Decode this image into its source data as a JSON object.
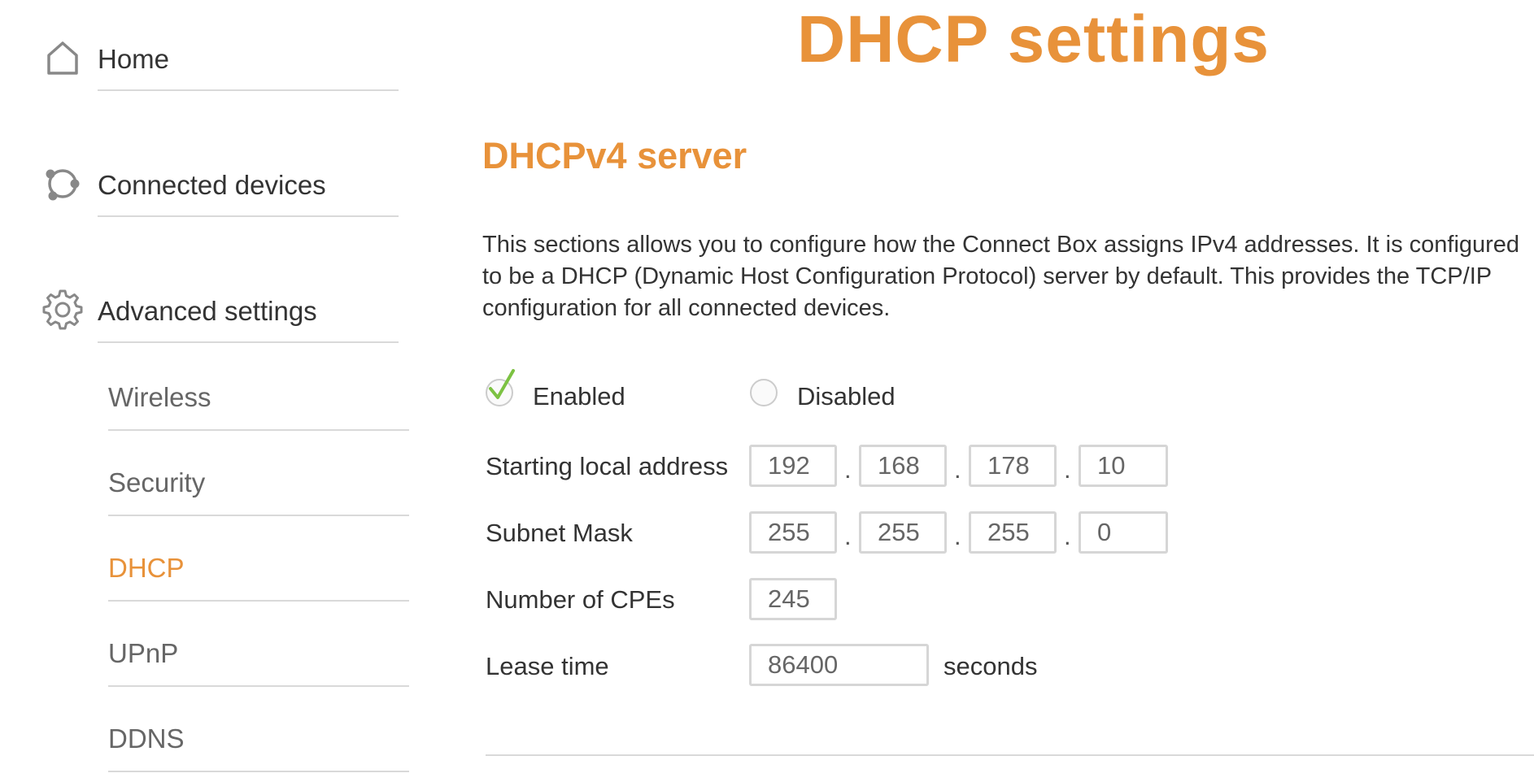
{
  "sidebar": {
    "home": {
      "label": "Home",
      "icon": "home-icon"
    },
    "connected_devices": {
      "label": "Connected devices",
      "icon": "connected-devices-icon"
    },
    "advanced_settings": {
      "label": "Advanced settings",
      "icon": "gear-icon"
    },
    "sub_items": [
      {
        "label": "Wireless",
        "active": false
      },
      {
        "label": "Security",
        "active": false
      },
      {
        "label": "DHCP",
        "active": true
      },
      {
        "label": "UPnP",
        "active": false
      },
      {
        "label": "DDNS",
        "active": false
      }
    ]
  },
  "main": {
    "page_title": "DHCP settings",
    "section_title": "DHCPv4 server",
    "description": "This sections allows you to configure how the Connect Box assigns IPv4 addresses. It is configured to be a DHCP (Dynamic Host Configuration Protocol) server by default. This provides the TCP/IP configuration for all connected devices.",
    "mode": {
      "enabled_label": "Enabled",
      "disabled_label": "Disabled",
      "selected": "enabled"
    },
    "form": {
      "starting_address": {
        "label": "Starting local address",
        "octets": [
          "192",
          "168",
          "178",
          "10"
        ]
      },
      "subnet_mask": {
        "label": "Subnet Mask",
        "octets": [
          "255",
          "255",
          "255",
          "0"
        ]
      },
      "cpes": {
        "label": "Number of CPEs",
        "value": "245"
      },
      "lease_time": {
        "label": "Lease time",
        "value": "86400",
        "unit": "seconds"
      },
      "separator": "."
    }
  },
  "colors": {
    "accent": "#e8923a",
    "check": "#7cc242",
    "divider": "#d9d9d9",
    "text": "#333333",
    "muted_text": "#666666"
  }
}
